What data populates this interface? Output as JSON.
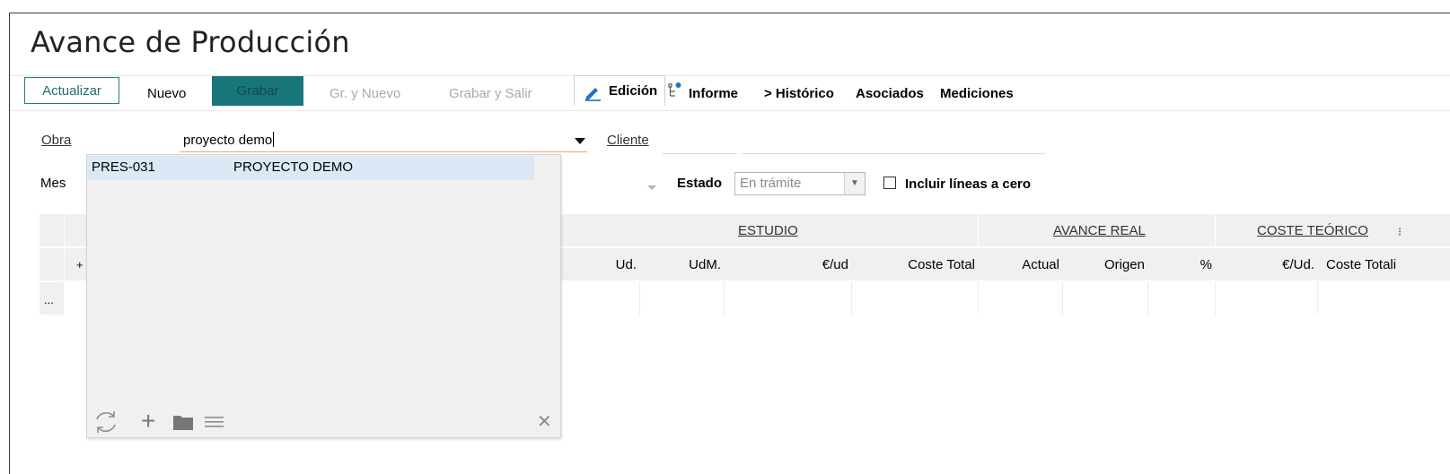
{
  "window": {
    "title": "Avance de Producción"
  },
  "toolbar": {
    "actualizar": "Actualizar",
    "nuevo": "Nuevo",
    "grabar": "Grabar",
    "gr_y_nuevo": "Gr. y Nuevo",
    "grabar_y_salir": "Grabar y Salir",
    "edicion": "Edición",
    "informe": "Informe",
    "historico": "> Histórico",
    "asociados": "Asociados",
    "mediciones": "Mediciones"
  },
  "form": {
    "obra_label": "Obra",
    "obra_value": "proyecto demo",
    "cliente_label": "Cliente",
    "mes_label": "Mes",
    "estado_label": "Estado",
    "estado_value": "En trámite",
    "incluir_label": "Incluir líneas a cero",
    "incluir_checked": false
  },
  "grid": {
    "groups": {
      "estudio": "ESTUDIO",
      "avance_real": "AVANCE REAL",
      "coste_teorico": "COSTE TEÓRICO"
    },
    "columns": [
      "Ud.",
      "UdM.",
      "€/ud",
      "Coste Total",
      "Actual",
      "Origen",
      "%",
      "€/Ud.",
      "Coste Totali"
    ],
    "plus": "+",
    "row_menu": "..."
  },
  "dropdown": {
    "items": [
      {
        "code": "PRES-031",
        "name": "PROYECTO DEMO"
      }
    ],
    "icons": [
      "refresh-icon",
      "plus-icon",
      "folder-icon",
      "menu-icon",
      "close-icon"
    ],
    "plus_glyph": "+",
    "close_glyph": "✕"
  },
  "colors": {
    "accent": "#187579",
    "selected_row": "#dbe9f7",
    "input_underline": "#e8a27a"
  }
}
